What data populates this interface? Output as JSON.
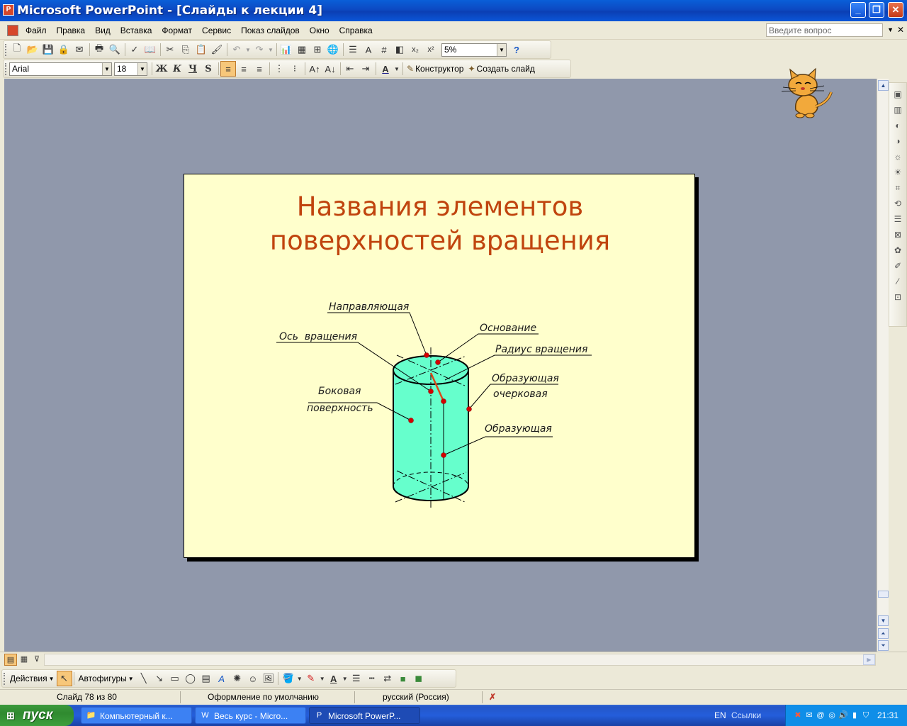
{
  "window": {
    "title": "Microsoft PowerPoint - [Слайды к лекции 4]",
    "icon": "powerpoint-icon",
    "controls": {
      "minimize": "_",
      "maximize": "❐",
      "close": "✕"
    }
  },
  "menubar": {
    "items": [
      "Файл",
      "Правка",
      "Вид",
      "Вставка",
      "Формат",
      "Сервис",
      "Показ слайдов",
      "Окно",
      "Справка"
    ],
    "help_placeholder": "Введите вопрос",
    "close_glyph": "✕"
  },
  "standard_toolbar": {
    "zoom": "5%",
    "superscript": "x²",
    "subscript": "x₂"
  },
  "formatting_toolbar": {
    "font": "Arial",
    "size": "18",
    "bold": "Ж",
    "italic": "К",
    "underline": "Ч",
    "shadow": "S",
    "designer_label": "Конструктор",
    "new_slide_label": "Создать слайд",
    "alignment": "left"
  },
  "slide": {
    "title_line1": "Названия элементов",
    "title_line2": "поверхностей вращения",
    "background": "#ffffcc",
    "title_color": "#c0440e",
    "cylinder_fill": "#66ffcc",
    "labels": {
      "guide": "Направляющая",
      "axis": "Ось  вращения",
      "base": "Основание",
      "radius": "Радиус вращения",
      "outline_gen_1": "Образующая",
      "outline_gen_2": "очерковая",
      "lateral_1": "Боковая",
      "lateral_2": "поверхность",
      "generatrix": "Образующая"
    }
  },
  "drawing_toolbar": {
    "actions_label": "Действия",
    "autoshapes_label": "Автофигуры"
  },
  "statusbar": {
    "slide_info": "Слайд 78 из 80",
    "design": "Оформление по умолчанию",
    "language": "русский (Россия)"
  },
  "taskbar": {
    "start_label": "пуск",
    "tasks": [
      {
        "label": "Компьютерный к...",
        "icon": "folder-icon"
      },
      {
        "label": "Весь курс - Micro...",
        "icon": "word-icon"
      },
      {
        "label": "Microsoft PowerP...",
        "icon": "powerpoint-icon"
      }
    ],
    "lang": "EN",
    "links_label": "Ссылки",
    "clock": "21:31"
  }
}
